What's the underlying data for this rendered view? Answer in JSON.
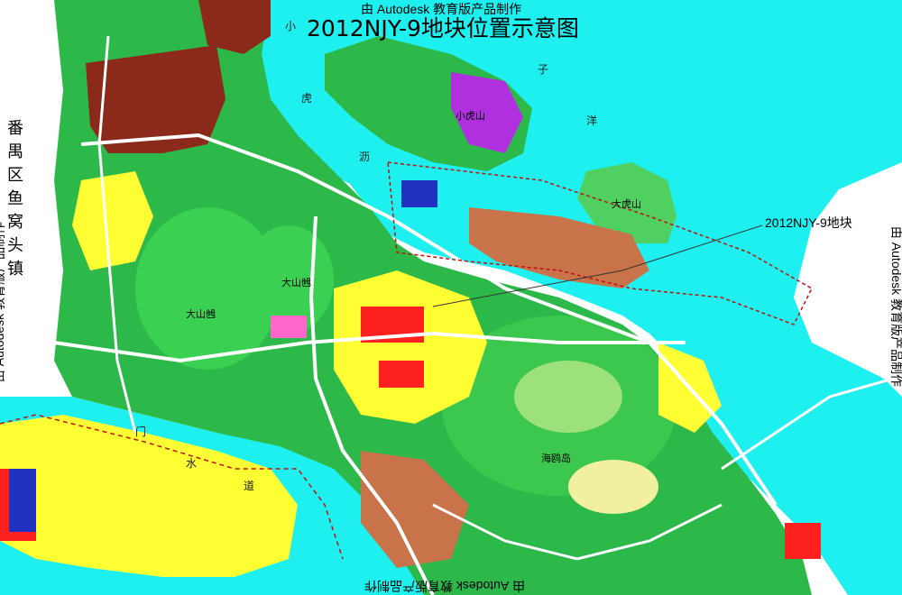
{
  "map": {
    "title": "2012NJY-9地块位置示意图",
    "watermark": "由 Autodesk 教育版产品制作",
    "callout_label": "2012NJY-9地块",
    "district_label": "番禺区鱼窝头镇",
    "place_labels": [
      "大山乸",
      "大山乸",
      "大虎山",
      "小虎山",
      "海鸥岛"
    ],
    "water_labels": [
      "小",
      "虎",
      "沥",
      "子",
      "洋",
      "门",
      "水",
      "道"
    ],
    "colors": {
      "water": "#1ef0f0",
      "green_space": "#2db84a",
      "park": "#4fd060",
      "residential": "#ffff33",
      "commercial": "#ff2020",
      "industrial": "#8b2a1a",
      "education": "#ff66cc",
      "purple": "#b030e0",
      "brown": "#c8734a",
      "road": "#ffffff",
      "boundary": "#c01010"
    }
  }
}
